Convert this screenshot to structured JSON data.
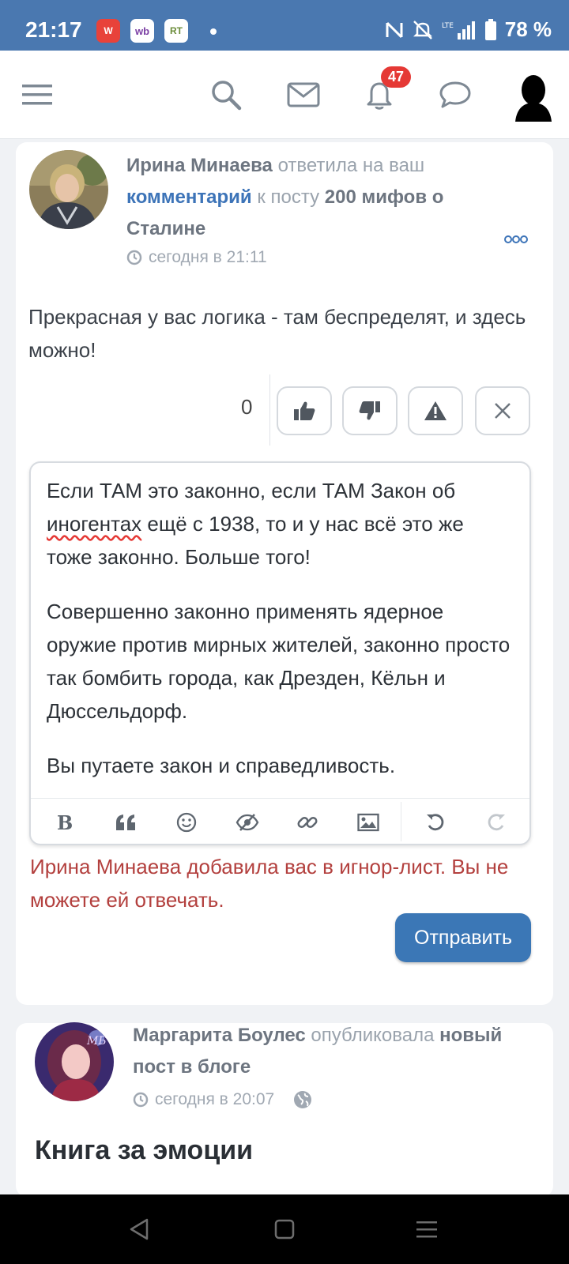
{
  "status_bar": {
    "time": "21:17",
    "apps": [
      "W",
      "wb",
      "RT"
    ],
    "battery": "78 %",
    "network": "LTE"
  },
  "nav": {
    "notification_count": "47"
  },
  "notification": {
    "author": "Ирина Минаева",
    "action_text": " ответила на ваш ",
    "comment_link": "комментарий",
    "to_post": " к посту ",
    "post_title": "200 мифов о Сталине",
    "time": "сегодня в 21:11",
    "comment_text": "Прекрасная у вас логика - там беспределят, и здесь можно!",
    "vote_count": "0"
  },
  "editor": {
    "p1_before": "Если ТАМ это законно, если ТАМ Закон об ",
    "p1_spell": "иногентах",
    "p1_after": " ещё с 1938, то и у нас всё это же тоже законно. Больше того!",
    "p2": "Совершенно законно применять ядерное оружие против мирных жителей, законно просто так бомбить города, как Дрезден, Кёльн и Дюссельдорф.",
    "p3": "Вы путаете закон и справедливость."
  },
  "ignore_message": "Ирина Минаева добавила вас в игнор-лист. Вы не можете ей отвечать.",
  "send_label": "Отправить",
  "notification2": {
    "author": "Маргарита Боулес",
    "action_text": " опубликовала ",
    "what": "новый пост в блоге",
    "time": "сегодня в 20:07",
    "post_title": "Книга за эмоции"
  },
  "colors": {
    "status_bar": "#4a78b0",
    "accent": "#3b77b6",
    "link": "#3d74b8",
    "badge": "#e53935",
    "warning_text": "#b3403e"
  }
}
